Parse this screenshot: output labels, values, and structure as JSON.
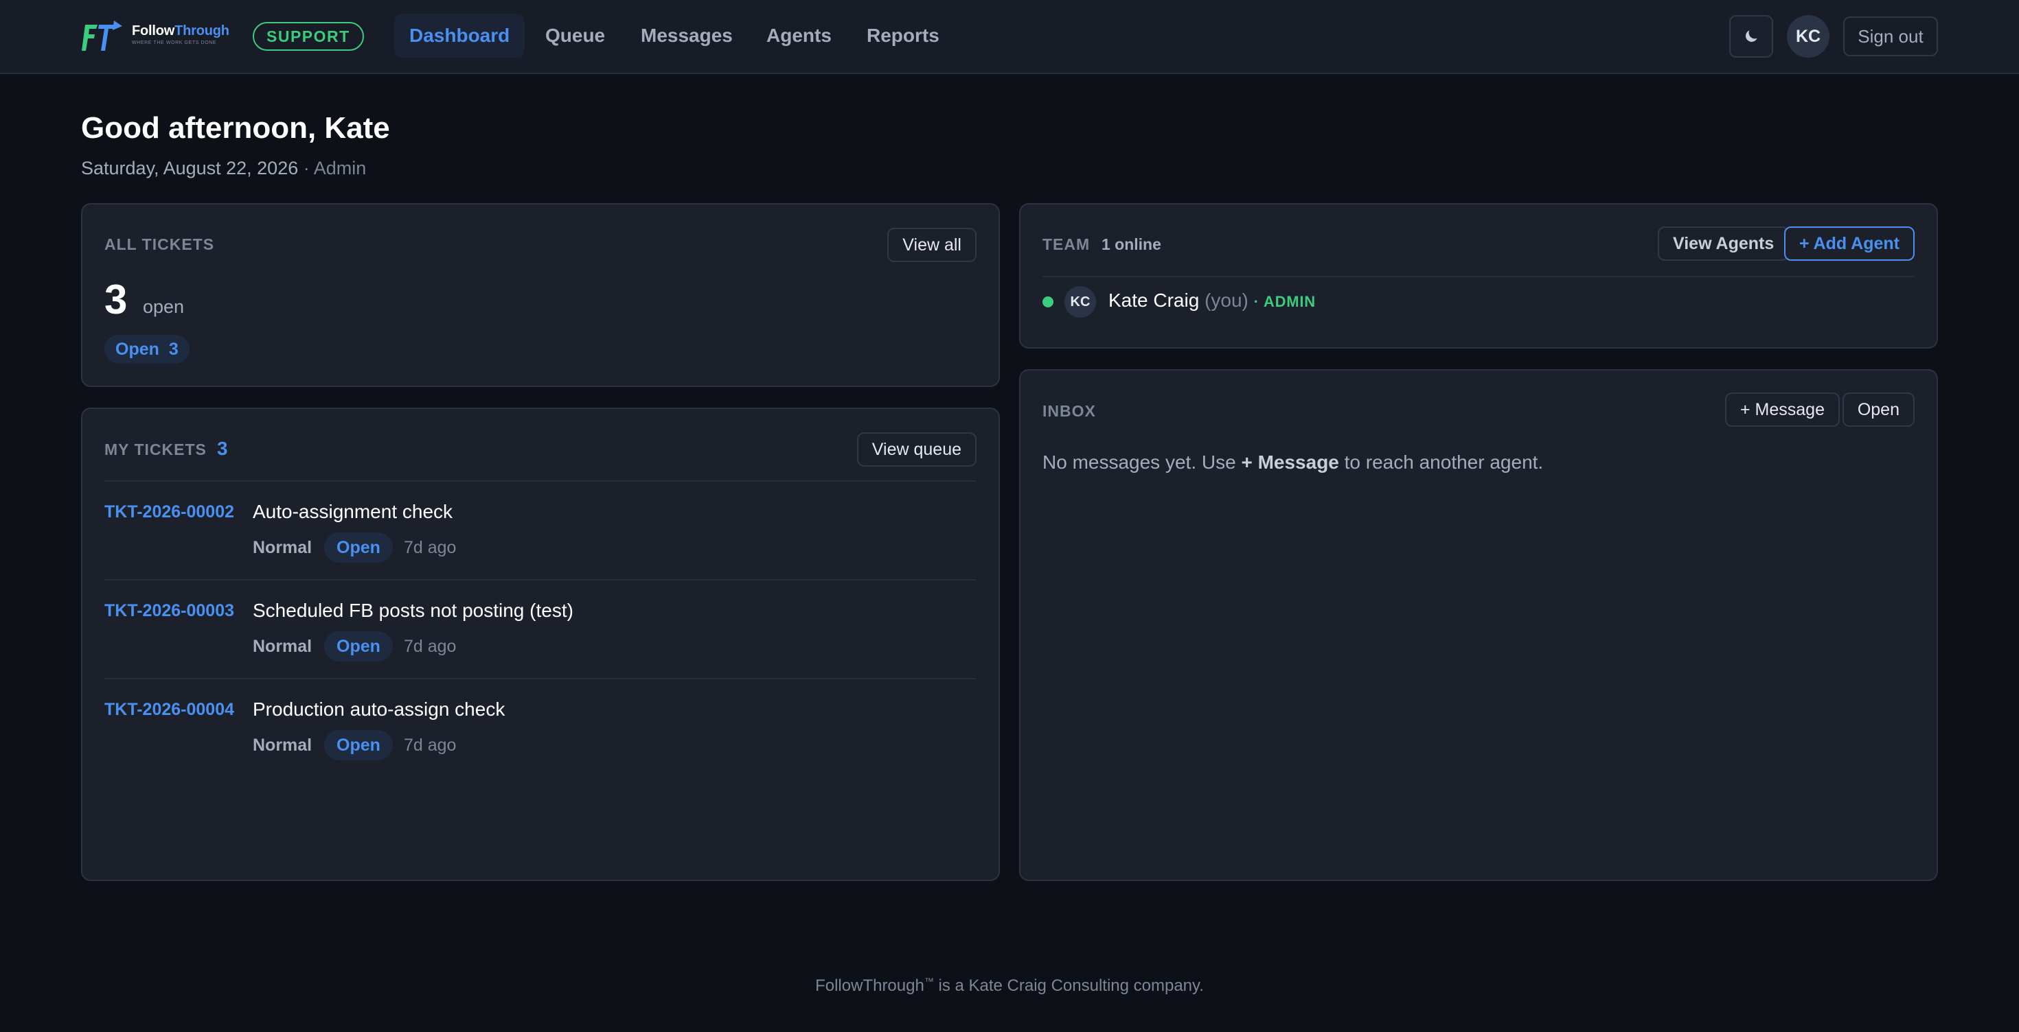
{
  "brand": {
    "name_part1": "Follow",
    "name_part2": "Through",
    "tagline": "WHERE THE WORK GETS DONE",
    "support_badge": "SUPPORT",
    "colors": {
      "blue": "#4a90f0",
      "green": "#3ccc7e"
    }
  },
  "nav": {
    "items": [
      {
        "label": "Dashboard",
        "active": true
      },
      {
        "label": "Queue"
      },
      {
        "label": "Messages"
      },
      {
        "label": "Agents"
      },
      {
        "label": "Reports"
      }
    ],
    "theme_icon": "moon-icon",
    "avatar_initials": "KC",
    "signout_label": "Sign out"
  },
  "greeting": {
    "title": "Good afternoon, Kate",
    "date": "Saturday, August 22, 2026",
    "separator": " · ",
    "role": "Admin"
  },
  "all_tickets": {
    "label": "ALL TICKETS",
    "view_all": "View all",
    "count": "3",
    "count_suffix": "open",
    "pill_label": "Open",
    "pill_count": "3"
  },
  "my_tickets": {
    "label": "MY TICKETS",
    "count": "3",
    "view_queue": "View queue",
    "tickets": [
      {
        "id": "TKT-2026-00002",
        "title": "Auto-assignment check",
        "priority": "Normal",
        "status": "Open",
        "age": "7d ago"
      },
      {
        "id": "TKT-2026-00003",
        "title": "Scheduled FB posts not posting (test)",
        "priority": "Normal",
        "status": "Open",
        "age": "7d ago"
      },
      {
        "id": "TKT-2026-00004",
        "title": "Production auto-assign check",
        "priority": "Normal",
        "status": "Open",
        "age": "7d ago"
      }
    ]
  },
  "team": {
    "label": "TEAM",
    "online": "1 online",
    "view_agents": "View Agents",
    "add_agent": "+ Add Agent",
    "members": [
      {
        "initials": "KC",
        "name": "Kate Craig",
        "you": "(you)",
        "role": "· ADMIN",
        "status": "online"
      }
    ]
  },
  "inbox": {
    "label": "INBOX",
    "message_btn": "+ Message",
    "open_btn": "Open",
    "empty_prefix": "No messages yet. Use ",
    "empty_bold": "+ Message",
    "empty_suffix": " to reach another agent."
  },
  "footer": {
    "company": "FollowThrough",
    "tm": "™",
    "text": " is a Kate Craig Consulting company."
  }
}
